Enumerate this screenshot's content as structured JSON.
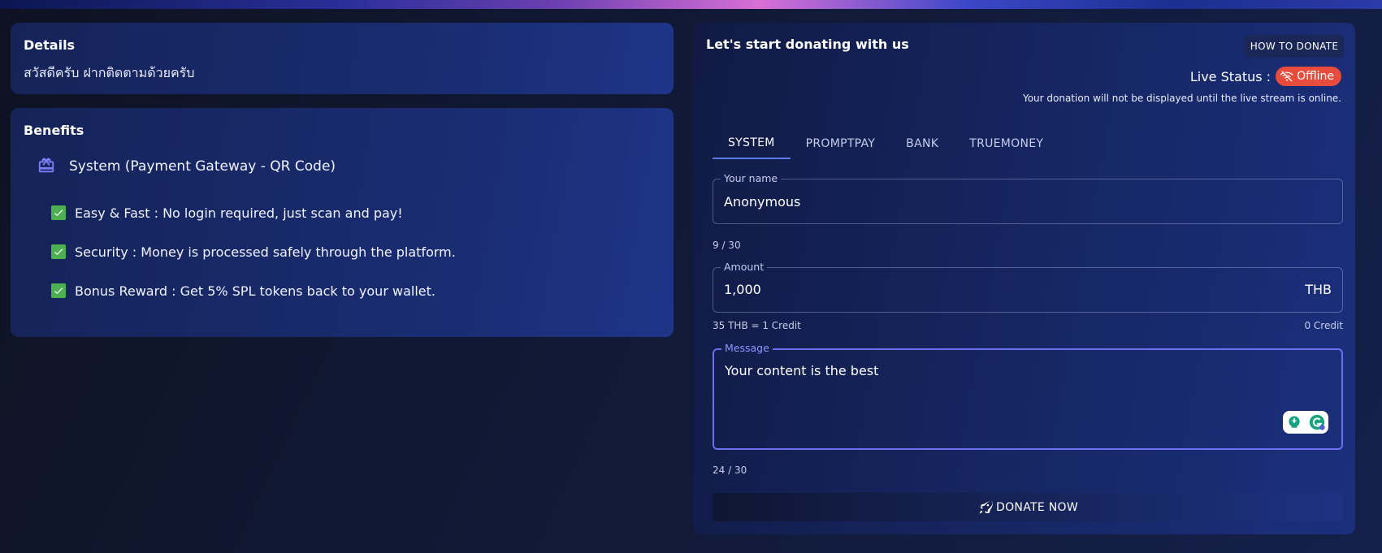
{
  "details": {
    "title": "Details",
    "text": "สวัสดีครับ ฝากติดตามด้วยครับ"
  },
  "benefits": {
    "title": "Benefits",
    "gateway_label": "System (Payment Gateway - QR Code)",
    "items": [
      "Easy & Fast : No login required, just scan and pay!",
      "Security : Money is processed safely through the platform.",
      "Bonus Reward : Get 5% SPL tokens back to your wallet."
    ]
  },
  "donate": {
    "title": "Let's start donating with us",
    "how_to_label": "HOW TO DONATE",
    "live_status_label": "Live Status :",
    "status_chip": "Offline",
    "warning": "Your donation will not be displayed until the live stream is online.",
    "tabs": [
      "SYSTEM",
      "PROMPTPAY",
      "BANK",
      "TRUEMONEY"
    ],
    "active_tab": "SYSTEM",
    "name_field": {
      "label": "Your name",
      "value": "Anonymous",
      "counter": "9 / 30"
    },
    "amount_field": {
      "label": "Amount",
      "value": "1,000",
      "suffix": "THB",
      "rate": "35 THB = 1 Credit",
      "credit": "0 Credit"
    },
    "message_field": {
      "label": "Message",
      "value": "Your content is the best",
      "counter": "24 / 30"
    },
    "submit_label": "DONATE NOW"
  },
  "colors": {
    "accent": "#5a7ce8",
    "check": "#4caf50",
    "offline": "#e74c3c",
    "focus": "#6b6ff0"
  },
  "icons": [
    "gift-card-icon",
    "check-icon",
    "wifi-off-icon",
    "rocket-icon",
    "grammarly-icon"
  ]
}
